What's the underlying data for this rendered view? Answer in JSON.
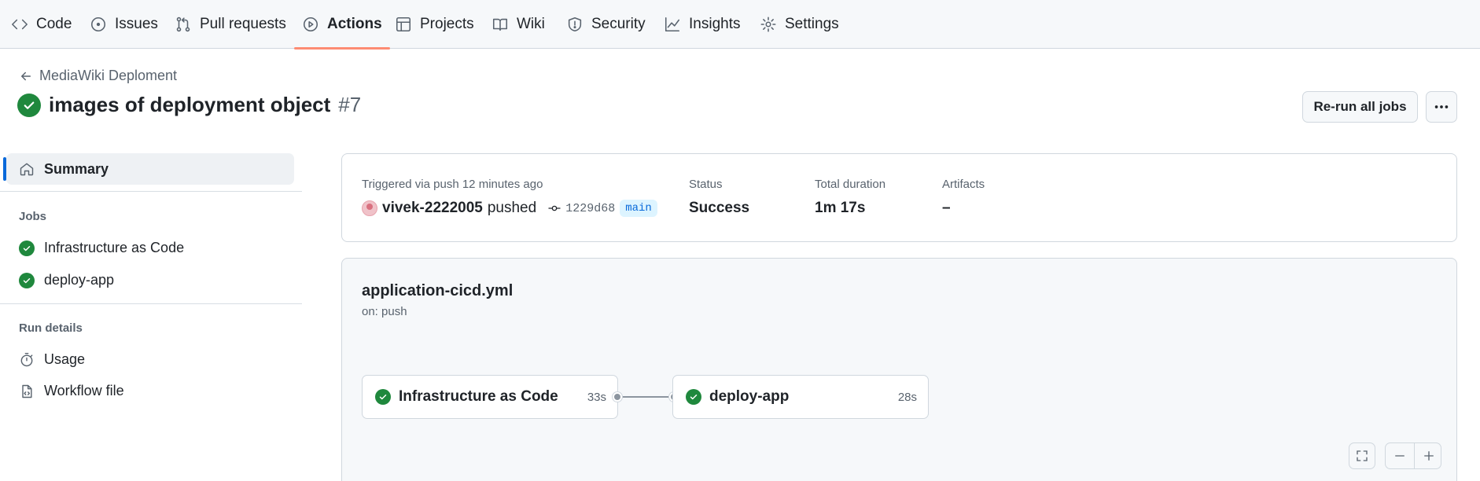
{
  "nav": {
    "tabs": [
      {
        "label": "Code",
        "icon": "code-icon"
      },
      {
        "label": "Issues",
        "icon": "issue-opened-icon"
      },
      {
        "label": "Pull requests",
        "icon": "git-pull-request-icon"
      },
      {
        "label": "Actions",
        "icon": "play-icon",
        "active": true
      },
      {
        "label": "Projects",
        "icon": "table-icon"
      },
      {
        "label": "Wiki",
        "icon": "book-icon"
      },
      {
        "label": "Security",
        "icon": "shield-icon"
      },
      {
        "label": "Insights",
        "icon": "graph-icon"
      },
      {
        "label": "Settings",
        "icon": "gear-icon"
      }
    ]
  },
  "header": {
    "back_label": "MediaWiki Deploment",
    "title": "images of deployment object",
    "run_number": "#7",
    "rerun_label": "Re-run all jobs"
  },
  "sidebar": {
    "summary_label": "Summary",
    "jobs_heading": "Jobs",
    "jobs": [
      "Infrastructure as Code",
      "deploy-app"
    ],
    "run_details_heading": "Run details",
    "usage_label": "Usage",
    "workflow_file_label": "Workflow file"
  },
  "summary": {
    "trigger_text": "Triggered via push 12 minutes ago",
    "actor": "vivek-2222005",
    "action": "pushed",
    "commit": "1229d68",
    "branch": "main",
    "status_label": "Status",
    "status_value": "Success",
    "duration_label": "Total duration",
    "duration_value": "1m 17s",
    "artifacts_label": "Artifacts",
    "artifacts_value": "–"
  },
  "workflow": {
    "file": "application-cicd.yml",
    "trigger": "on: push",
    "jobs": [
      {
        "name": "Infrastructure as Code",
        "duration": "33s"
      },
      {
        "name": "deploy-app",
        "duration": "28s"
      }
    ]
  },
  "colors": {
    "success": "#1f883d",
    "active_underline": "#fd8c73",
    "accent": "#0969da"
  }
}
